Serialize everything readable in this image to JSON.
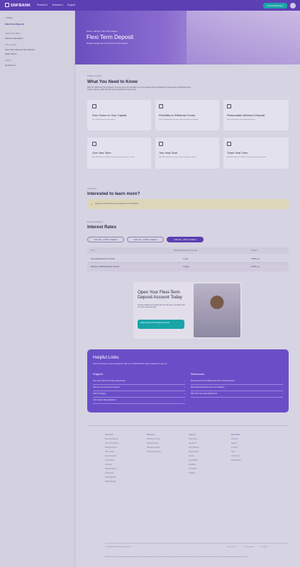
{
  "topnav": {
    "brand": "SNFBANK",
    "links": [
      "Personal ▾",
      "Business ▾",
      "Support"
    ],
    "cta_label": "Online Banking ▾"
  },
  "sidebar": {
    "back_label": "< Home",
    "current": "Flexi Term Deposit",
    "groups": [
      {
        "heading": "Options and Rates",
        "items": [
          "Interest Calculation"
        ]
      },
      {
        "heading": "Term Deposits",
        "items": [
          "Flexi Term Deposit with Interest",
          "Static Terms"
        ]
      },
      {
        "heading": "Support",
        "items": [
          "Contact Us"
        ]
      }
    ]
  },
  "hero": {
    "crumb": "Home > Savings > Flexi Term Deposit",
    "title": "Flexi Term Deposit",
    "subtitle": "Flexible savings with the benefits of a term deposit"
  },
  "need_to_know": {
    "eyebrow": "Product overview",
    "title": "What You Need to Know",
    "body": "With the SNF Flexi Term Deposit, you can enjoy the benefits of a term deposit with the flexibility of being able to withdraw funds before maturity, while still earning a competitive interest rate.",
    "cards": [
      {
        "icon": "piggy-bank-icon",
        "title": "Earn Gains on Your Capital",
        "desc": "Get a fixed return on your money."
      },
      {
        "icon": "bank-building-icon",
        "title": "Flexibility to Withdraw Funds",
        "desc": "Up to 3 withdrawals per term without breaking the deposit."
      },
      {
        "icon": "coins-icon",
        "title": "Reasonable Minimum Deposit",
        "desc": "Start saving from a low minimum balance."
      },
      {
        "icon": "calendar-icon",
        "title": "One Year Term",
        "desc": "A flexible deposit in SNF for one year with the option to renew."
      },
      {
        "icon": "calendar-icon",
        "title": "Two Year Term",
        "desc": "A flexible deposit of two years with competitive interest."
      },
      {
        "icon": "calendar-icon",
        "title": "Three Year Term",
        "desc": "A flexible deposit in SNF for three years with higher rates."
      }
    ]
  },
  "learn_more": {
    "eyebrow": "Learn more",
    "title": "Interested to learn more?",
    "notice": "Read the product disclosure statement for SNF Bank."
  },
  "rates": {
    "eyebrow": "Flexi Term Deposit",
    "title": "Interest Rates",
    "tabs": [
      "Cash rate - 1.75% on balance",
      "Cash rate - 2.25% on balance",
      "Cash rate - 2.5% on balance"
    ],
    "active_tab": 2,
    "headers": [
      "Term",
      "Withdrawal penalty in the year",
      "Interest"
    ],
    "rows": [
      [
        "Non-withdrawal view of funds",
        "1 year",
        "1.50% p.a."
      ],
      [
        "Maximum withdrawal view of funds",
        "3 years",
        "2.20% p.a."
      ]
    ]
  },
  "promo": {
    "title": "Open Your Flexi-Term Deposit Account Today",
    "body": "Create a flexible term deposit with one easy step. Get started with your online banking today.",
    "button_label": "Apply for Flexi Term Deposit Account"
  },
  "helpful": {
    "title": "Helpful Links",
    "subtitle": "Didn't find what you were looking for? Call us on 1800 000 000. We're available to help you.",
    "support_title": "Support",
    "support_links": [
      "How can I find the best term deposit rate?",
      "How do I earn more from interest?",
      "Tariff of Charges",
      "Your Interest Rate Explained"
    ],
    "resources_title": "Resources",
    "resources_links": [
      "Specific Terms & Conditions Flexi Term Deposit Account",
      "SNF Business Product Terms & Conditions",
      "SNF Flexi Term Deposit Brochure"
    ]
  },
  "footer": {
    "columns": [
      {
        "heading": "Personal",
        "links": [
          "Bank and Savings",
          "Flexi Term Deposit",
          "Savings Account",
          "Home Loans",
          "Personal Loans",
          "Credit Cards",
          "Insurance",
          "Superannuation",
          "Investments",
          "Online Banking",
          "Mobile Banking"
        ]
      },
      {
        "heading": "Business",
        "links": [
          "Business Accounts",
          "Business Loans",
          "Merchant Services",
          "Business Insurance"
        ]
      },
      {
        "heading": "Support",
        "links": [
          "Help Centre",
          "Contact Us",
          "Find a Branch",
          "Report Fraud",
          "Security",
          "Accessibility",
          "Feedback",
          "Complaints",
          "Hardship"
        ]
      },
      {
        "heading": "SNF Bank",
        "links": [
          "About Us",
          "Careers",
          "Investors",
          "News",
          "Community",
          "Sustainability"
        ]
      }
    ],
    "copyright": "© 2024 SNF Bank. All rights reserved.",
    "bottom_links": [
      "Terms of use",
      "Privacy Policy",
      "Site Map"
    ],
    "legal": "SNF Bank Ltd. Any information provided is general in nature and does not take into account your objectives, financial situation or needs. Please read the relevant terms and conditions before making a decision."
  }
}
